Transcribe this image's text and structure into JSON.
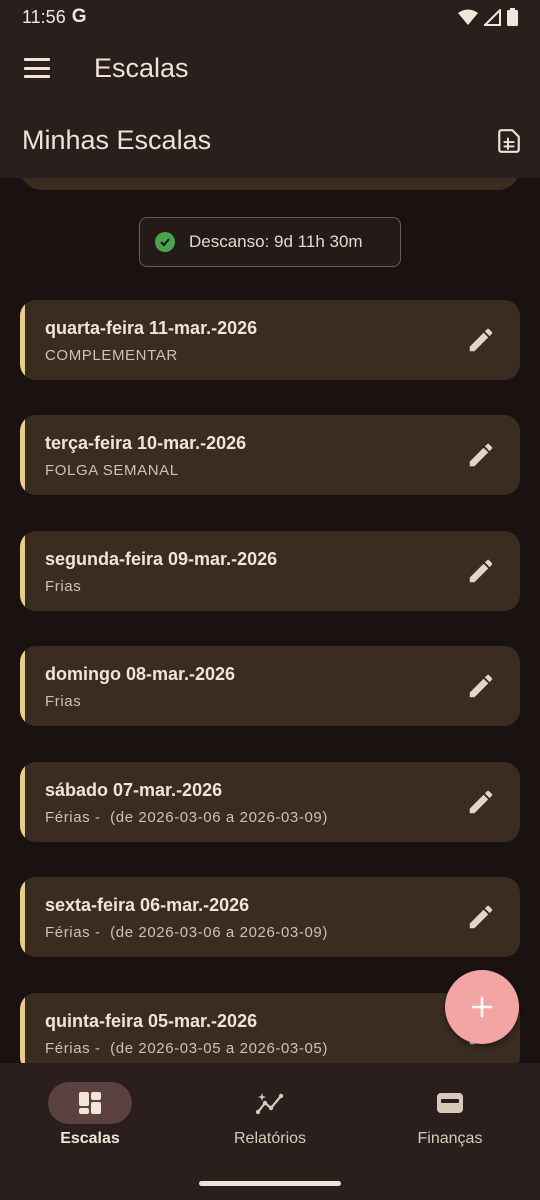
{
  "status_bar": {
    "time": "11:56",
    "g_logo": "G"
  },
  "app_bar": {
    "title": "Escalas",
    "menu_icon": "hamburger-menu-icon"
  },
  "section": {
    "title": "Minhas Escalas",
    "action_icon": "sheet-document-icon"
  },
  "rest_chip": {
    "text": "Descanso: 9d 11h 30m",
    "icon": "check-circle-icon",
    "icon_color": "#49a54c"
  },
  "schedules": [
    {
      "date": "quarta-feira 11-mar.-2026",
      "desc": "COMPLEMENTAR"
    },
    {
      "date": "terça-feira 10-mar.-2026",
      "desc": "FOLGA SEMANAL"
    },
    {
      "date": "segunda-feira 09-mar.-2026",
      "desc": "Frias"
    },
    {
      "date": "domingo 08-mar.-2026",
      "desc": "Frias"
    },
    {
      "date": "sábado 07-mar.-2026",
      "desc": "Férias -  (de 2026-03-06 a 2026-03-09)"
    },
    {
      "date": "sexta-feira 06-mar.-2026",
      "desc": "Férias -  (de 2026-03-06 a 2026-03-09)"
    },
    {
      "date": "quinta-feira 05-mar.-2026",
      "desc": "Férias -  (de 2026-03-05 a 2026-03-05)"
    }
  ],
  "fab": {
    "icon": "plus-icon",
    "color": "#f2a5a2"
  },
  "bottom_nav": {
    "items": [
      {
        "label": "Escalas",
        "icon": "dashboard-icon",
        "active": true
      },
      {
        "label": "Relatórios",
        "icon": "insights-icon",
        "active": false
      },
      {
        "label": "Finanças",
        "icon": "wallet-icon",
        "active": false
      }
    ]
  },
  "colors": {
    "accent": "#e8cf85",
    "card": "#3a2c21",
    "background": "#1a1210",
    "bar": "#2a1f1c"
  }
}
